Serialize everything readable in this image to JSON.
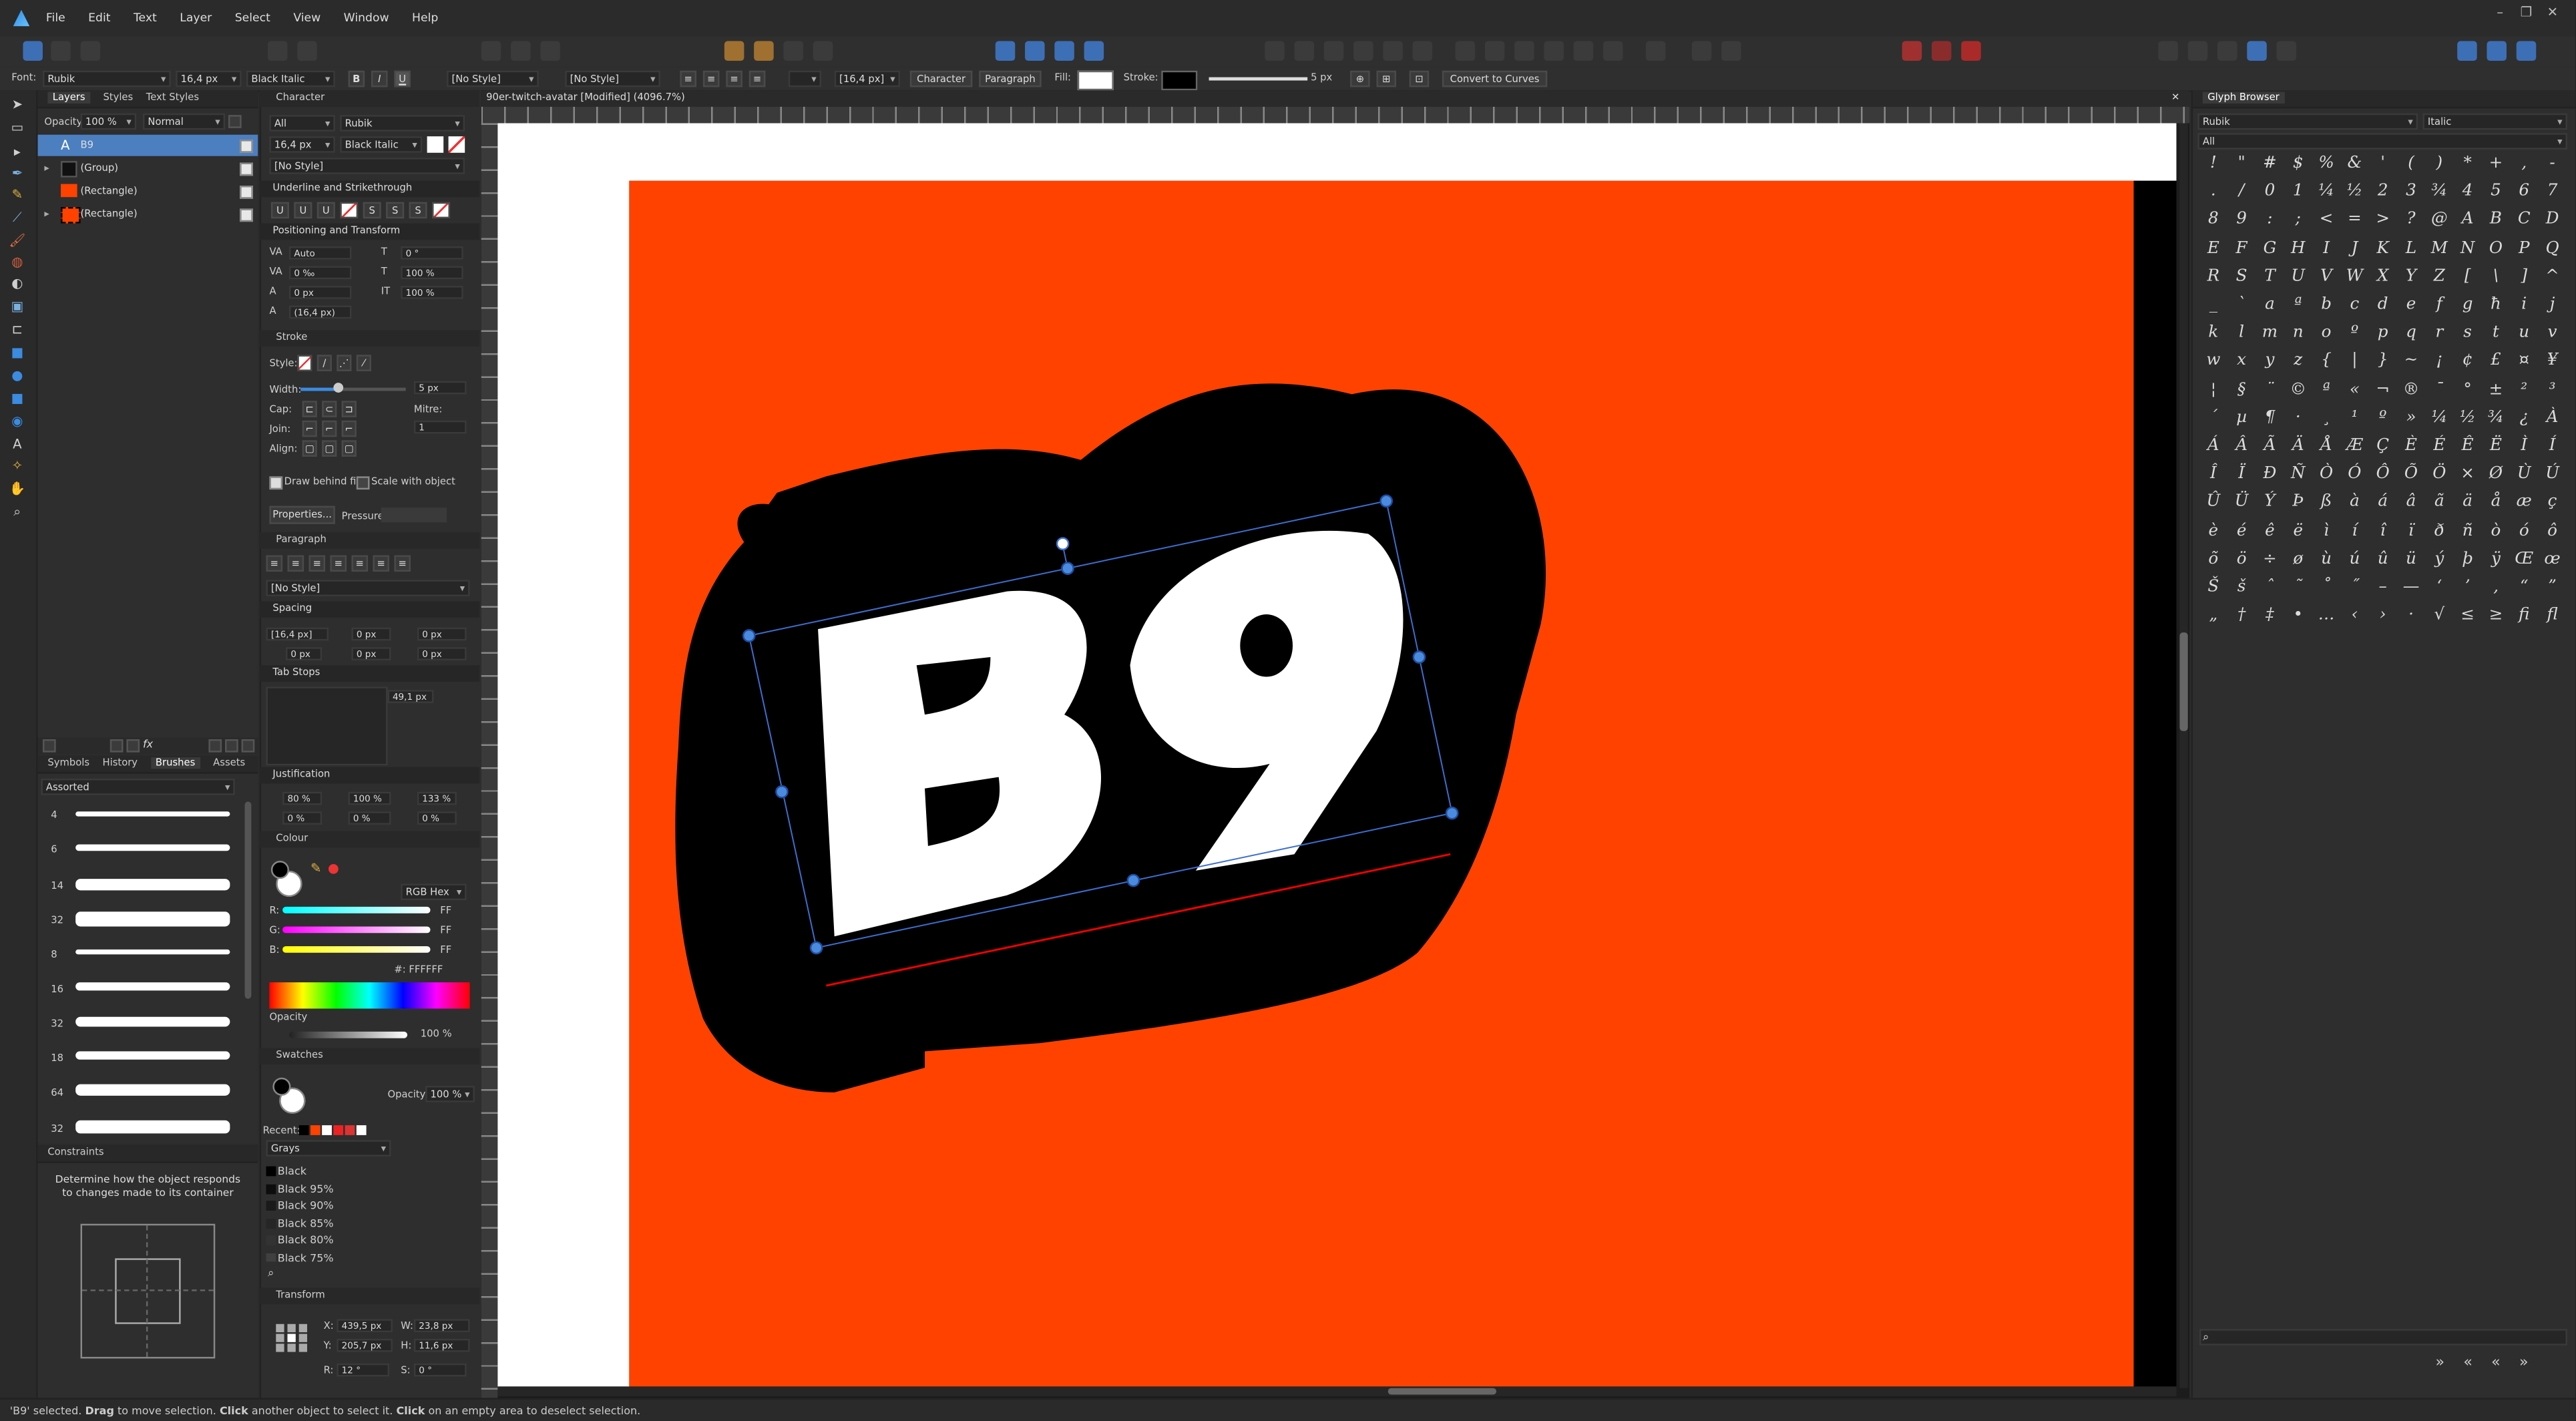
{
  "app": {
    "title": "90er-twitch-avatar [Modified] (4096.7%)"
  },
  "menu": [
    "File",
    "Edit",
    "Text",
    "Layer",
    "Select",
    "View",
    "Window",
    "Help"
  ],
  "context": {
    "font_label": "Font:",
    "font": "Rubik",
    "size": "16,4 px",
    "style": "Black Italic",
    "char_style": "[No Style]",
    "para_style": "[No Style]",
    "leading": "[16,4 px]",
    "character_btn": "Character",
    "paragraph_btn": "Paragraph",
    "fill_label": "Fill:",
    "stroke_label": "Stroke:",
    "stroke_width": "5 px",
    "convert_btn": "Convert to Curves"
  },
  "layers_panel": {
    "tabs": [
      "Layers",
      "Styles",
      "Text Styles"
    ],
    "opacity_label": "Opacity:",
    "opacity": "100 %",
    "blend": "Normal",
    "items": [
      {
        "name": "B9",
        "kind": "text"
      },
      {
        "name": "(Group)",
        "kind": "group"
      },
      {
        "name": "(Rectangle)",
        "kind": "rect"
      },
      {
        "name": "(Rectangle)",
        "kind": "rect"
      }
    ]
  },
  "brushes_panel": {
    "tabs": [
      "Symbols",
      "History",
      "Brushes",
      "Assets"
    ],
    "category": "Assorted",
    "sizes": [
      "4",
      "6",
      "14",
      "32",
      "8",
      "16",
      "32",
      "18",
      "64",
      "32"
    ]
  },
  "constraints": {
    "title": "Constraints",
    "text": "Determine how the object responds to changes made to its container"
  },
  "character": {
    "title": "Character",
    "scope": "All",
    "font": "Rubik",
    "size": "16,4 px",
    "style": "Black Italic",
    "style_name": "[No Style]",
    "underline_title": "Underline and Strikethrough",
    "pos_title": "Positioning and Transform",
    "kerning": "Auto",
    "tracking": "0 ‰",
    "baseline": "0 px",
    "shear": "0 °",
    "vscale": "100 %",
    "hscale": "100 %",
    "leading": "(16,4 px)"
  },
  "stroke": {
    "title": "Stroke",
    "style_label": "Style:",
    "width_label": "Width:",
    "width": "5 px",
    "cap_label": "Cap:",
    "join_label": "Join:",
    "mitre_label": "Mitre:",
    "mitre": "1",
    "align_label": "Align:",
    "behind": "Draw behind fill",
    "scale": "Scale with object",
    "properties": "Properties...",
    "pressure": "Pressure:"
  },
  "paragraph": {
    "title": "Paragraph",
    "style": "[No Style]",
    "spacing_title": "Spacing",
    "leading": "[16,4 px]",
    "space_before": "0 px",
    "space_after": "0 px",
    "indent_l": "0 px",
    "indent_r": "0 px",
    "indent_f": "0 px",
    "tabs_title": "Tab Stops",
    "tab_value": "49,1 px",
    "justification_title": "Justification",
    "word_min": "80 %",
    "word_desired": "100 %",
    "word_max": "133 %",
    "letter_min": "0 %",
    "letter_desired": "0 %",
    "letter_max": "0 %"
  },
  "colour": {
    "title": "Colour",
    "mode": "RGB Hex",
    "r_label": "R:",
    "g_label": "G:",
    "b_label": "B:",
    "r": "FF",
    "g": "FF",
    "b": "FF",
    "hex": "#: FFFFFF",
    "opacity_label": "Opacity",
    "opacity": "100 %"
  },
  "swatches": {
    "title": "Swatches",
    "opacity_label": "Opacity:",
    "opacity": "100 %",
    "recent_label": "Recent:",
    "palette": "Grays",
    "items": [
      "Black",
      "Black 95%",
      "Black 90%",
      "Black 85%",
      "Black 80%",
      "Black 75%"
    ]
  },
  "transform": {
    "title": "Transform",
    "x_label": "X:",
    "x": "439,5 px",
    "y_label": "Y:",
    "y": "205,7 px",
    "w_label": "W:",
    "w": "23,8 px",
    "h_label": "H:",
    "h": "11,6 px",
    "r_label": "R:",
    "r": "12 °",
    "s_label": "S:",
    "s": "0 °"
  },
  "canvas": {
    "text": "B9",
    "bg_color": "#ff4200",
    "shadow_color": "#000000",
    "text_color": "#ffffff"
  },
  "glyphs": {
    "title": "Glyph Browser",
    "font": "Rubik",
    "style": "Italic",
    "subset": "All",
    "chars": [
      "!",
      "\"",
      "#",
      "$",
      "%",
      "&",
      "'",
      "(",
      ")",
      "*",
      "+",
      ",",
      "-",
      ".",
      "/",
      "0",
      "1",
      "¼",
      "½",
      "2",
      "3",
      "¾",
      "4",
      "5",
      "6",
      "7",
      "8",
      "9",
      ":",
      ";",
      "<",
      "=",
      ">",
      "?",
      "@",
      "A",
      "B",
      "C",
      "D",
      "E",
      "F",
      "G",
      "H",
      "I",
      "J",
      "K",
      "L",
      "M",
      "N",
      "O",
      "P",
      "Q",
      "R",
      "S",
      "T",
      "U",
      "V",
      "W",
      "X",
      "Y",
      "Z",
      "[",
      "\\",
      "]",
      "^",
      "_",
      "`",
      "a",
      "ª",
      "b",
      "c",
      "d",
      "e",
      "f",
      "g",
      "ħ",
      "i",
      "j",
      "k",
      "l",
      "m",
      "n",
      "o",
      "º",
      "p",
      "q",
      "r",
      "s",
      "t",
      "u",
      "v",
      "w",
      "x",
      "y",
      "z",
      "{",
      "|",
      "}",
      "~",
      "¡",
      "¢",
      "£",
      "¤",
      "¥",
      "¦",
      "§",
      "¨",
      "©",
      "ª",
      "«",
      "¬",
      "®",
      "¯",
      "°",
      "±",
      "²",
      "³",
      "´",
      "µ",
      "¶",
      "·",
      "¸",
      "¹",
      "º",
      "»",
      "¼",
      "½",
      "¾",
      "¿",
      "À",
      "Á",
      "Â",
      "Ã",
      "Ä",
      "Å",
      "Æ",
      "Ç",
      "È",
      "É",
      "Ê",
      "Ë",
      "Ì",
      "Í",
      "Î",
      "Ï",
      "Ð",
      "Ñ",
      "Ò",
      "Ó",
      "Ô",
      "Õ",
      "Ö",
      "×",
      "Ø",
      "Ù",
      "Ú",
      "Û",
      "Ü",
      "Ý",
      "Þ",
      "ß",
      "à",
      "á",
      "â",
      "ã",
      "ä",
      "å",
      "æ",
      "ç",
      "è",
      "é",
      "ê",
      "ë",
      "ì",
      "í",
      "î",
      "ï",
      "ð",
      "ñ",
      "ò",
      "ó",
      "ô",
      "õ",
      "ö",
      "÷",
      "ø",
      "ù",
      "ú",
      "û",
      "ü",
      "ý",
      "þ",
      "ÿ",
      "Œ",
      "œ",
      "Š",
      "š",
      "ˆ",
      "˜",
      "˚",
      "˝",
      "–",
      "—",
      "‘",
      "’",
      "‚",
      "“",
      "”",
      "„",
      "†",
      "‡",
      "•",
      "…",
      "‹",
      "›",
      "·",
      "√",
      "≤",
      "≥",
      "ﬁ",
      "ﬂ"
    ],
    "nav": [
      "»",
      "«",
      "«",
      "»"
    ]
  },
  "status": {
    "selected": "'B9' selected.",
    "drag": "Drag",
    "drag_text": "to move selection.",
    "click": "Click",
    "click_text": "another object to select it.",
    "click2": "Click",
    "click2_text": "on an empty area to deselect selection."
  }
}
